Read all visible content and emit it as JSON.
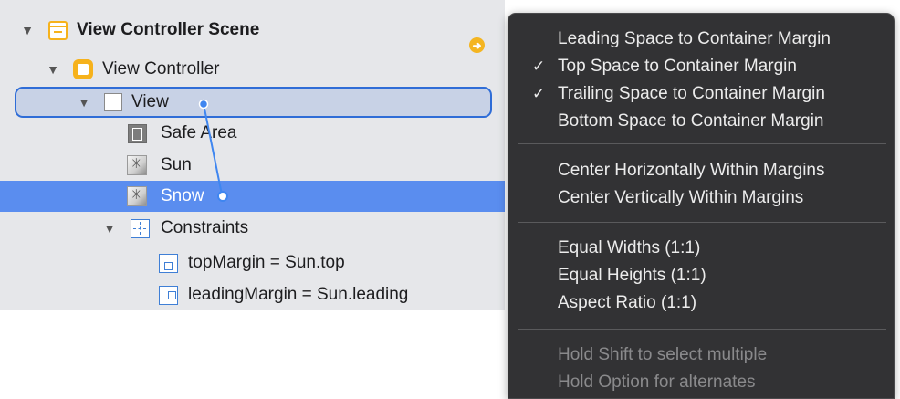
{
  "outline": {
    "scene_label": "View Controller Scene",
    "vc_label": "View Controller",
    "view_label": "View",
    "safe_area_label": "Safe Area",
    "sun_label": "Sun",
    "snow_label": "Snow",
    "constraints_label": "Constraints",
    "constraint_1": "topMargin = Sun.top",
    "constraint_2": "leadingMargin = Sun.leading",
    "disclosure": "▼",
    "badge": "➜"
  },
  "menu": {
    "groups": [
      [
        {
          "label": "Leading Space to Container Margin",
          "checked": false
        },
        {
          "label": "Top Space to Container Margin",
          "checked": true
        },
        {
          "label": "Trailing Space to Container Margin",
          "checked": true
        },
        {
          "label": "Bottom Space to Container Margin",
          "checked": false
        }
      ],
      [
        {
          "label": "Center Horizontally Within Margins",
          "checked": false
        },
        {
          "label": "Center Vertically Within Margins",
          "checked": false
        }
      ],
      [
        {
          "label": "Equal Widths (1:1)",
          "checked": false
        },
        {
          "label": "Equal Heights (1:1)",
          "checked": false
        },
        {
          "label": "Aspect Ratio (1:1)",
          "checked": false
        }
      ]
    ],
    "check_glyph": "✓",
    "hints": [
      "Hold Shift to select multiple",
      "Hold Option for alternates"
    ]
  },
  "colors": {
    "selection_blue": "#5a8def",
    "view_outline": "#2f6dd7",
    "menu_bg": "#323234",
    "scene_yellow": "#f6b21c"
  }
}
